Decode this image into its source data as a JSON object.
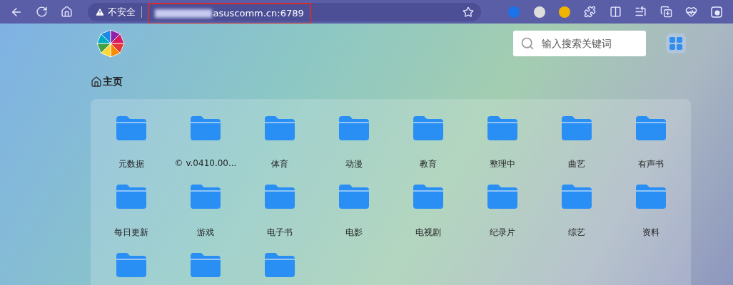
{
  "browser": {
    "security_label": "不安全",
    "url_visible": "asuscomm.cn:6789"
  },
  "header": {
    "search": {
      "placeholder": "输入搜索关键词"
    }
  },
  "breadcrumb": {
    "label": "主页"
  },
  "folders": [
    {
      "kind": "folder",
      "label": "元数据"
    },
    {
      "kind": "folder",
      "label": "© v.0410.00..."
    },
    {
      "kind": "folder",
      "label": "体育"
    },
    {
      "kind": "folder",
      "label": "动漫"
    },
    {
      "kind": "folder",
      "label": "教育"
    },
    {
      "kind": "folder",
      "label": "整理中"
    },
    {
      "kind": "folder",
      "label": "曲艺"
    },
    {
      "kind": "folder",
      "label": "有声书"
    },
    {
      "kind": "folder",
      "label": "每日更新"
    },
    {
      "kind": "folder",
      "label": "游戏"
    },
    {
      "kind": "folder",
      "label": "电子书"
    },
    {
      "kind": "folder",
      "label": "电影"
    },
    {
      "kind": "folder",
      "label": "电视剧"
    },
    {
      "kind": "folder",
      "label": "纪录片"
    },
    {
      "kind": "folder",
      "label": "综艺"
    },
    {
      "kind": "folder",
      "label": "资料"
    },
    {
      "kind": "folder"
    },
    {
      "kind": "folder"
    },
    {
      "kind": "folder"
    }
  ]
}
